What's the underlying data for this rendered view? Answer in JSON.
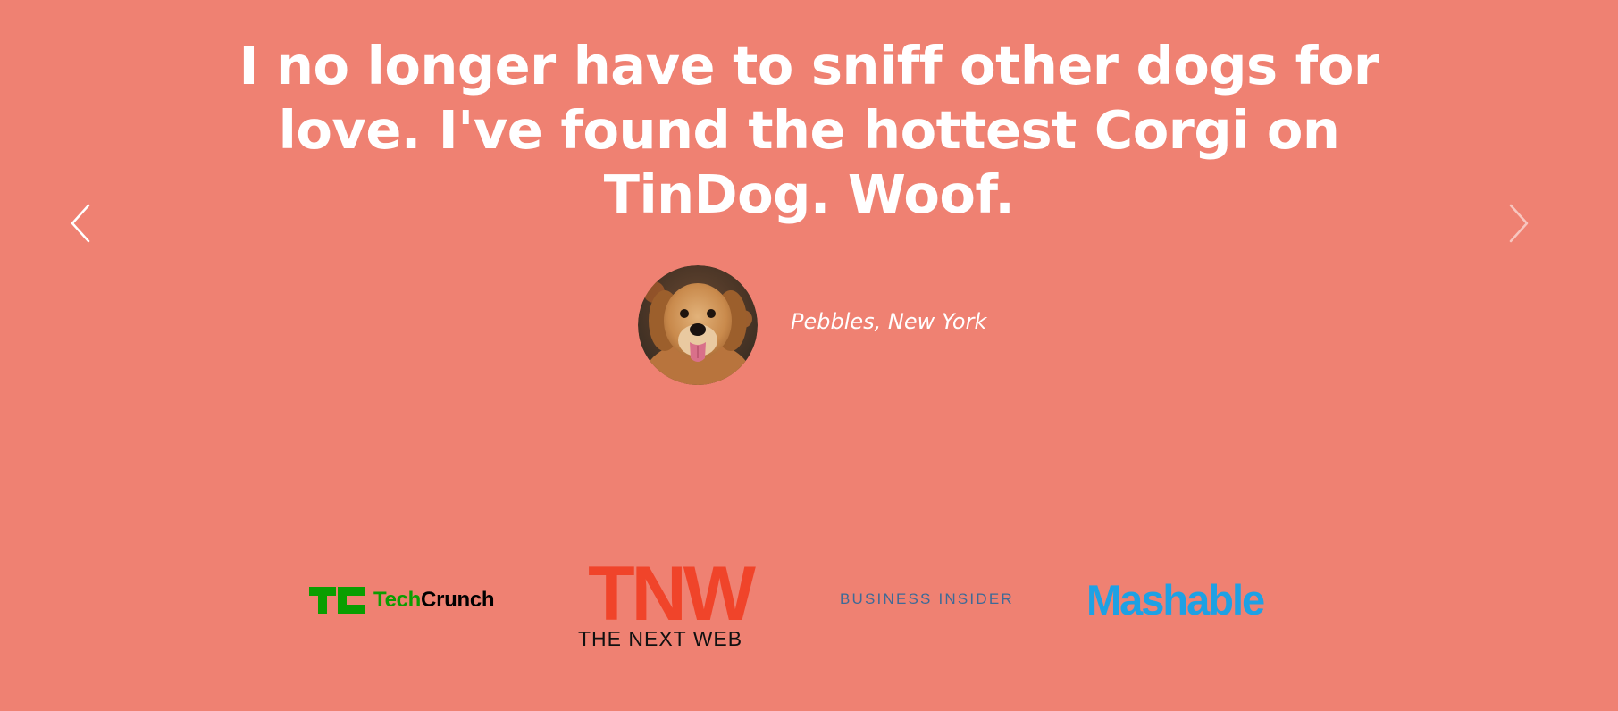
{
  "testimonial": {
    "quote_lines": [
      "I no longer have to sniff other dogs for",
      "love. I've found the hottest Corgi on",
      "TinDog. Woof."
    ],
    "author": "Pebbles, New York",
    "avatar_icon": "dog-avatar-image"
  },
  "carousel": {
    "prev_icon": "chevron-left-icon",
    "next_icon": "chevron-right-icon"
  },
  "press": {
    "logos": [
      {
        "name": "TechCrunch",
        "part1": "Tech",
        "part2": "Crunch",
        "color1": "#0a9e01",
        "color2": "#000000"
      },
      {
        "name": "TNW",
        "mark": "TNW",
        "subtitle": "THE NEXT WEB",
        "color": "#f0442a"
      },
      {
        "name": "Business Insider",
        "text": "BUSINESS INSIDER",
        "color": "#3e6a97"
      },
      {
        "name": "Mashable",
        "text": "Mashable",
        "color": "#1ea1e4"
      }
    ]
  },
  "colors": {
    "background": "#ef8172",
    "text": "#ffffff"
  }
}
